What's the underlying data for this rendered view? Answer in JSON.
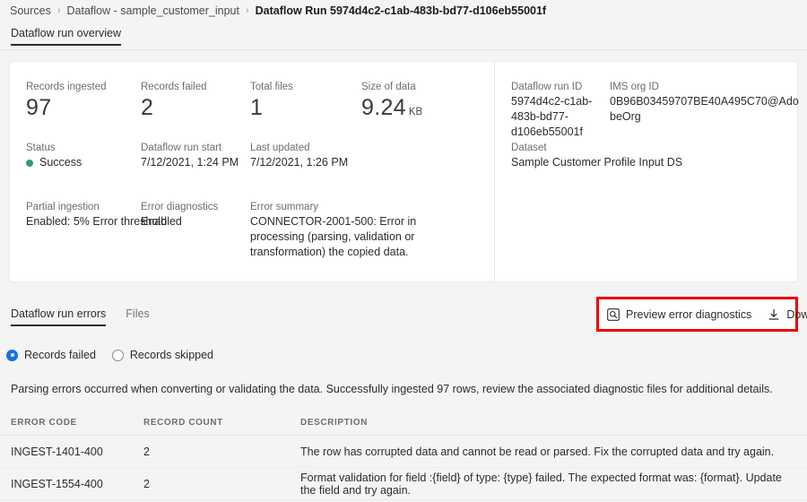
{
  "breadcrumb": {
    "items": [
      {
        "label": "Sources",
        "current": false
      },
      {
        "label": "Dataflow - sample_customer_input",
        "current": false
      },
      {
        "label": "Dataflow Run 5974d4c2-c1ab-483b-bd77-d106eb55001f",
        "current": true
      }
    ],
    "separator": "›"
  },
  "top_tab": {
    "label": "Dataflow run overview"
  },
  "summary": {
    "records_ingested": {
      "label": "Records ingested",
      "value": "97"
    },
    "records_failed": {
      "label": "Records failed",
      "value": "2"
    },
    "total_files": {
      "label": "Total files",
      "value": "1"
    },
    "size_of_data": {
      "label": "Size of data",
      "value": "9.24",
      "unit": "KB"
    },
    "status": {
      "label": "Status",
      "value": "Success",
      "color": "#2d9d78"
    },
    "run_start": {
      "label": "Dataflow run start",
      "value": "7/12/2021, 1:24 PM"
    },
    "last_updated": {
      "label": "Last updated",
      "value": "7/12/2021, 1:26 PM"
    },
    "partial_ingestion": {
      "label": "Partial ingestion",
      "value": "Enabled: 5% Error threshold"
    },
    "error_diagnostics": {
      "label": "Error diagnostics",
      "value": "Enabled"
    },
    "error_summary": {
      "label": "Error summary",
      "value": "CONNECTOR-2001-500: Error in processing (parsing, validation or transformation) the copied data."
    },
    "dataflow_run_id": {
      "label": "Dataflow run ID",
      "value": "5974d4c2-c1ab-483b-bd77-d106eb55001f"
    },
    "ims_org_id": {
      "label": "IMS org ID",
      "value": "0B96B03459707BE40A495C70@AdobeOrg"
    },
    "dataset": {
      "label": "Dataset",
      "value": "Sample Customer Profile Input DS"
    }
  },
  "section_tabs": [
    {
      "label": "Dataflow run errors",
      "active": true
    },
    {
      "label": "Files",
      "active": false
    }
  ],
  "actions": {
    "highlight_color": "#ee0000",
    "preview": {
      "label": "Preview error diagnostics",
      "icon": "preview-magnifier-icon"
    },
    "download": {
      "label": "Download",
      "icon": "download-icon"
    }
  },
  "filters": {
    "records_failed": {
      "label": "Records failed",
      "selected": true
    },
    "records_skipped": {
      "label": "Records skipped",
      "selected": false
    },
    "accent": "#1473e6"
  },
  "description": "Parsing errors occurred when converting or validating the data. Successfully ingested 97 rows, review the associated diagnostic files for additional details.",
  "table": {
    "columns": [
      "ERROR CODE",
      "RECORD COUNT",
      "DESCRIPTION"
    ],
    "rows": [
      {
        "code": "INGEST-1401-400",
        "count": "2",
        "description": "The row has corrupted data and cannot be read or parsed. Fix the corrupted data and try again."
      },
      {
        "code": "INGEST-1554-400",
        "count": "2",
        "description": "Format validation for field :{field} of type: {type} failed. The expected format was: {format}. Update the field and try again."
      }
    ]
  }
}
